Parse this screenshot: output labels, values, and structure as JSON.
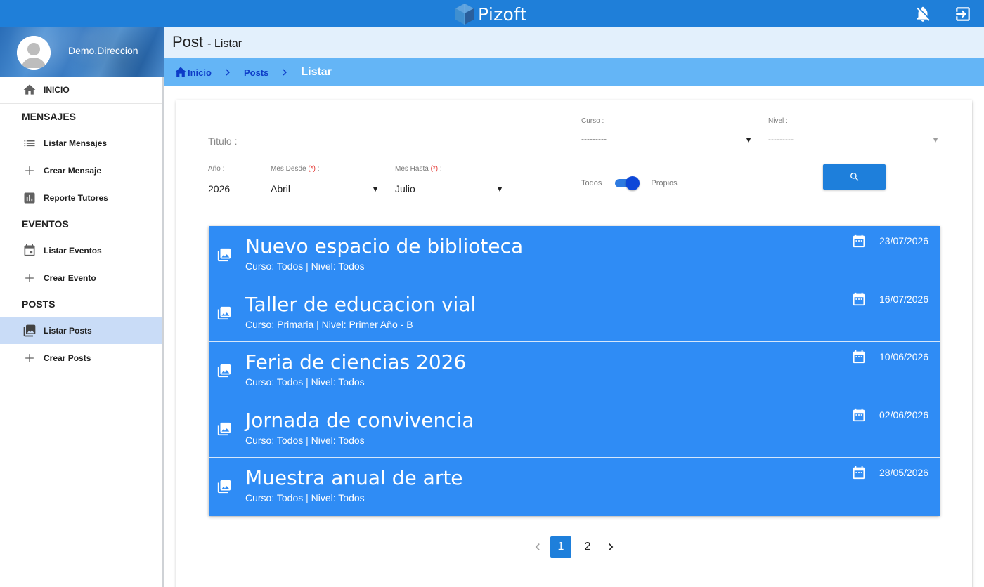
{
  "app": {
    "brand": "Pizoft"
  },
  "colors": {
    "topbar": "#1f7fd9",
    "list_item": "#2f8cf5",
    "breadcrumb_bg": "#64b5f6",
    "header_bg": "#e3f0fc",
    "active_nav": "#c9dcf7",
    "accent": "#1e7fdb"
  },
  "topbar": {
    "icons": [
      "notifications-off-icon",
      "logout-icon"
    ]
  },
  "sidebar": {
    "user": "Demo.Direccion",
    "inicio": "INICIO",
    "sections": {
      "mensajes": "MENSAJES",
      "eventos": "EVENTOS",
      "posts": "POSTS"
    },
    "items": {
      "listar_mensajes": "Listar Mensajes",
      "crear_mensaje": "Crear Mensaje",
      "reporte_tutores": "Reporte Tutores",
      "listar_eventos": "Listar Eventos",
      "crear_evento": "Crear Evento",
      "listar_posts": "Listar Posts",
      "crear_posts": "Crear Posts"
    }
  },
  "header": {
    "title": "Post",
    "subtitle": "- Listar"
  },
  "breadcrumb": {
    "home": "Inicio",
    "section": "Posts",
    "current": "Listar"
  },
  "filters": {
    "titulo_placeholder": "Titulo :",
    "curso_label": "Curso :",
    "curso_value": "---------",
    "nivel_label": "Nivel :",
    "nivel_value": "---------",
    "anio_label": "Año :",
    "anio_value": "2026",
    "mes_desde_label": "Mes Desde",
    "mes_desde_value": "Abril",
    "mes_hasta_label": "Mes Hasta",
    "mes_hasta_value": "Julio",
    "required_mark": "(*)",
    "colon": ":",
    "toggle_left": "Todos",
    "toggle_right": "Propios",
    "toggle_on": true
  },
  "posts": [
    {
      "title": "Nuevo espacio de biblioteca",
      "meta": "Curso: Todos | Nivel: Todos",
      "date": "23/07/2026"
    },
    {
      "title": "Taller de educacion vial",
      "meta": "Curso: Primaria | Nivel: Primer Año - B",
      "date": "16/07/2026"
    },
    {
      "title": "Feria de ciencias 2026",
      "meta": "Curso: Todos | Nivel: Todos",
      "date": "10/06/2026"
    },
    {
      "title": "Jornada de convivencia",
      "meta": "Curso: Todos | Nivel: Todos",
      "date": "02/06/2026"
    },
    {
      "title": "Muestra anual de arte",
      "meta": "Curso: Todos | Nivel: Todos",
      "date": "28/05/2026"
    }
  ],
  "pagination": {
    "pages": [
      "1",
      "2"
    ],
    "current": "1"
  }
}
